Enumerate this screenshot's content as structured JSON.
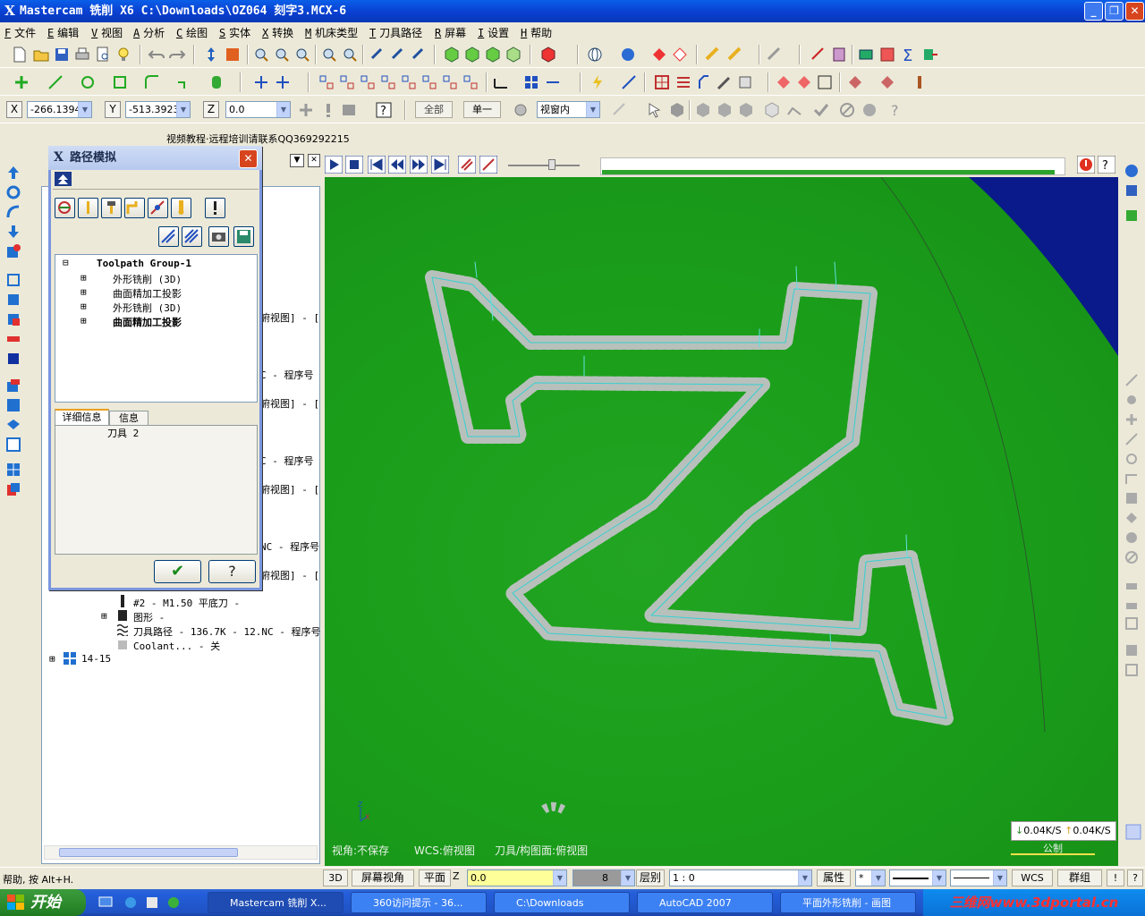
{
  "window": {
    "title": "Mastercam 铣削 X6  C:\\Downloads\\OZ064 刻字3.MCX-6",
    "controls": [
      "minimize",
      "restore",
      "close"
    ]
  },
  "menu": [
    {
      "key": "F",
      "label": "文件"
    },
    {
      "key": "E",
      "label": "编辑"
    },
    {
      "key": "V",
      "label": "视图"
    },
    {
      "key": "A",
      "label": "分析"
    },
    {
      "key": "C",
      "label": "绘图"
    },
    {
      "key": "S",
      "label": "实体"
    },
    {
      "key": "X",
      "label": "转换"
    },
    {
      "key": "M",
      "label": "机床类型"
    },
    {
      "key": "T",
      "label": "刀具路径"
    },
    {
      "key": "R",
      "label": "屏幕"
    },
    {
      "key": "I",
      "label": "设置"
    },
    {
      "key": "H",
      "label": "帮助"
    }
  ],
  "coords": {
    "x_label": "X",
    "x_value": "-266.1394",
    "y_label": "Y",
    "y_value": "-513.3923",
    "z_label": "Z",
    "z_value": "0.0",
    "all_button": "全部",
    "single_button": "单一",
    "view_select": "视窗内"
  },
  "video_note": "视频教程·远程培训请联系QQ369292215",
  "sim_dialog": {
    "title": "路径模拟",
    "tree_root": "Toolpath Group-1",
    "tree_items": [
      "外形铣削 (3D)",
      "曲面精加工投影",
      "外形铣削 (3D)",
      "曲面精加工投影"
    ],
    "tabs": [
      "详细信息",
      "信息"
    ],
    "detail_text": "刀具 2",
    "ok_label": "✔",
    "help_label": "?"
  },
  "manager_tree": {
    "partials": [
      "俯视图] - [",
      "C - 程序号",
      "俯视图] - [",
      "C - 程序号",
      "俯视图] - [",
      "NC - 程序号",
      "俯视图] - ["
    ],
    "tool_item": "#2 - M1.50 平底刀 -",
    "geometry_item": "图形 -",
    "toolpath_item": "刀具路径 - 136.7K - 12.NC - 程序号",
    "coolant_item": "Coolant... - 关",
    "group_item": "14-15"
  },
  "viewport": {
    "status_left": "视角:不保存",
    "status_wcs": "WCS:俯视图",
    "status_tool": "刀具/构图面:俯视图",
    "units": "公制",
    "net_down": "0.04K/S",
    "net_up": "0.04K/S",
    "background_color": "#1a9e1a",
    "part_edge_color": "#0a1a8a",
    "path_color": "#b8c0bc"
  },
  "simulation_progress": 0.98,
  "statusbar": {
    "help": "帮助, 按 Alt+H.",
    "mode_3d": "3D",
    "screen_view": "屏幕视角",
    "plane": "平面",
    "z_label": "Z",
    "z_value": "0.0",
    "color_value": "8",
    "level_label": "层别",
    "level_value": "1 : 0",
    "attr_label": "属性",
    "wcs": "WCS",
    "group": "群组",
    "excl": "!"
  },
  "taskbar": {
    "start": "开始",
    "tasks": [
      "Mastercam 铣削 X...",
      "360访问提示 - 36...",
      "C:\\Downloads",
      "AutoCAD 2007",
      "平面外形铣削 - 画图"
    ],
    "watermark": "三维网www.3dportal.cn"
  }
}
